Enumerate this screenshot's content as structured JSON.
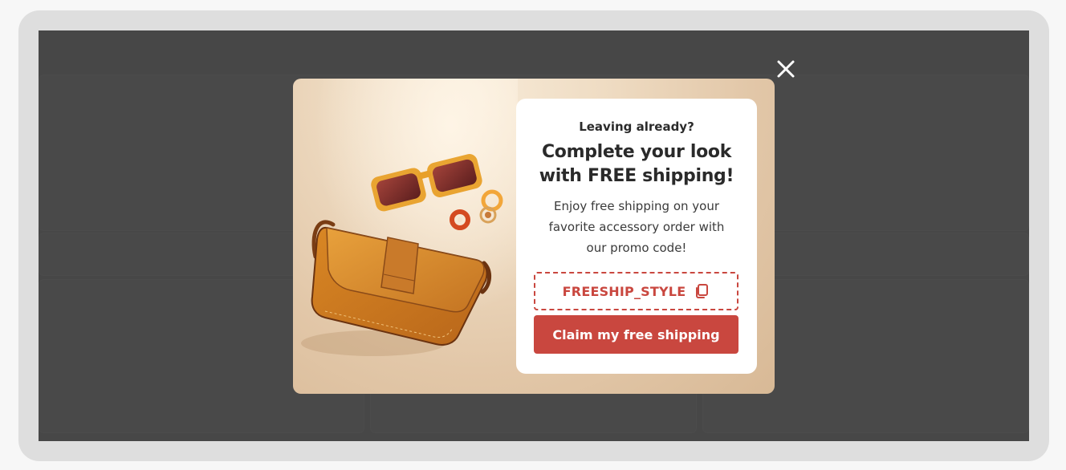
{
  "popup": {
    "eyebrow": "Leaving already?",
    "headline_line1": "Complete your look",
    "headline_line2": "with FREE shipping!",
    "body_line1": "Enjoy free shipping on your",
    "body_line2": "favorite accessory order with",
    "body_line3": "our promo code!",
    "promo_code": "FREESHIP_STYLE",
    "cta_label": "Claim my free shipping",
    "close_icon": "close-icon",
    "copy_icon": "copy-icon",
    "image_subject": "Orange leather crossbody bag, orange sunglasses and rings"
  },
  "colors": {
    "accent": "#c9473f",
    "overlay": "#474747",
    "card": "#ffffff",
    "text_dark": "#2a2a2a",
    "photo_bg": "#efdcc3"
  }
}
